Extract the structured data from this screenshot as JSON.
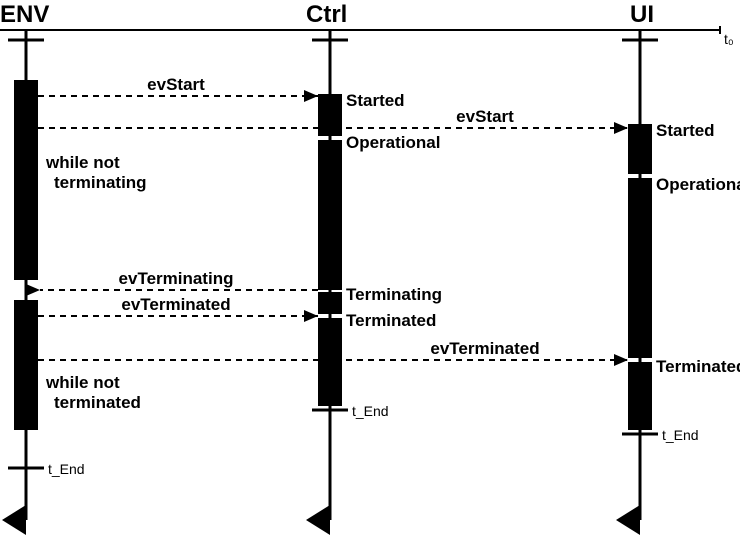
{
  "lifelines": {
    "env": {
      "name": "ENV",
      "t0": "t₀",
      "tend": "t_End"
    },
    "ctrl": {
      "name": "Ctrl",
      "t0": "t₀",
      "tend": "t_End"
    },
    "ui": {
      "name": "UI",
      "t0": "t₀",
      "tend": "t_End"
    }
  },
  "messages": {
    "m_env_ctrl_start": "evStart",
    "m_ctrl_ui_start": "evStart",
    "m_ctrl_env_terminating": "evTerminating",
    "m_env_ctrl_terminated": "evTerminated",
    "m_ctrl_ui_terminated": "evTerminated"
  },
  "states": {
    "ctrl_started": "Started",
    "ctrl_operational": "Operational",
    "ctrl_terminating": "Terminating",
    "ctrl_terminated": "Terminated",
    "ui_started": "Started",
    "ui_operational": "Operational",
    "ui_terminated": "Terminated"
  },
  "conditions": {
    "env_not_terminating_1": "while not",
    "env_not_terminating_2": "terminating",
    "env_not_terminated_1": "while not",
    "env_not_terminated_2": "terminated"
  }
}
